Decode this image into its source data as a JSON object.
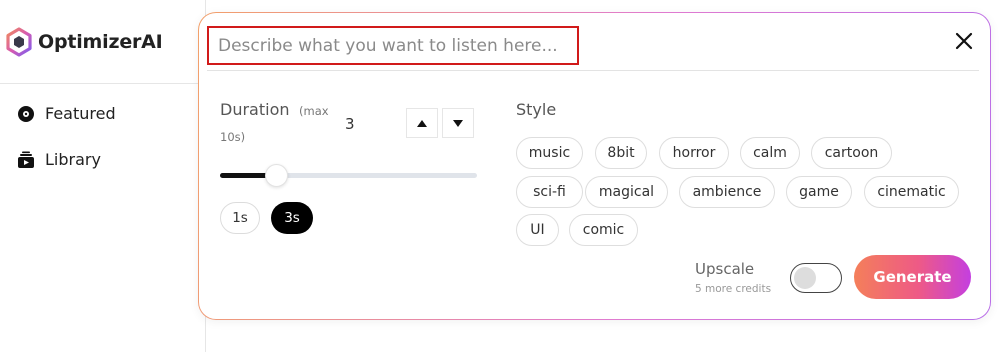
{
  "app": {
    "name": "OptimizerAI"
  },
  "sidebar": {
    "items": [
      {
        "label": "Featured",
        "icon": "disc-icon"
      },
      {
        "label": "Library",
        "icon": "library-icon"
      }
    ]
  },
  "modal": {
    "prompt": {
      "placeholder": "Describe what you want to listen here...",
      "value": ""
    },
    "close_icon": "close-icon",
    "duration": {
      "label": "Duration",
      "hint_line1": "(max",
      "hint_line2": "10s)",
      "value": "3",
      "min": 1,
      "max": 10,
      "current": 3,
      "presets": [
        "1s",
        "3s"
      ],
      "selected_preset": "3s"
    },
    "style": {
      "label": "Style",
      "options": [
        "music",
        "8bit",
        "horror",
        "calm",
        "cartoon",
        "sci-fi",
        "magical",
        "ambience",
        "game",
        "cinematic",
        "UI",
        "comic"
      ]
    },
    "upscale": {
      "label": "Upscale",
      "sub": "5 more credits",
      "enabled": false
    },
    "generate_label": "Generate"
  },
  "colors": {
    "highlight_border": "#d11a1a",
    "generate_gradient_start": "#f47f5a",
    "generate_gradient_end": "#c43fe0",
    "selected_preset_bg": "#000000"
  }
}
